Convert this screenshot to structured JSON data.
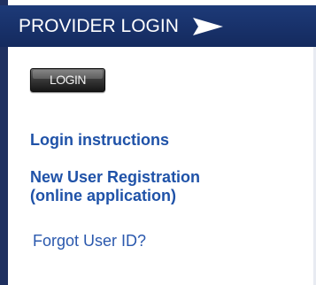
{
  "header": {
    "title": "PROVIDER LOGIN",
    "arrow_icon": "arrow-right-icon"
  },
  "login_button": {
    "label": "LOGIN"
  },
  "links": {
    "instructions": "Login instructions",
    "registration_line1": "New User Registration",
    "registration_line2": "(online application)",
    "forgot_user_id": "Forgot User ID?"
  },
  "colors": {
    "header_bg": "#16306a",
    "link": "#1f52a8",
    "button_bg": "#2a2a2a"
  }
}
